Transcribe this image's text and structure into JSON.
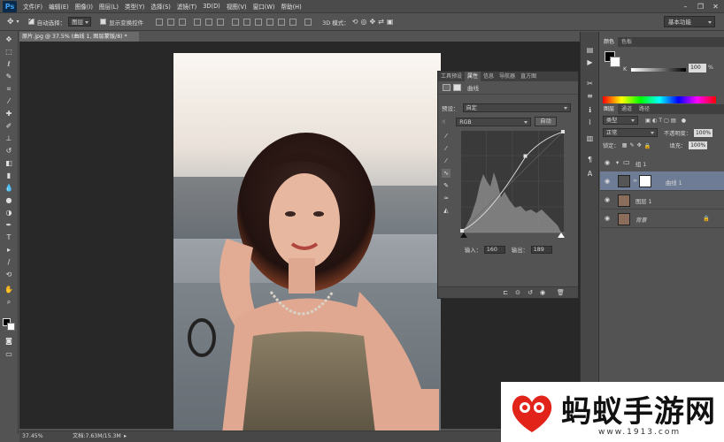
{
  "app": {
    "logo": "Ps"
  },
  "menu": [
    "文件(F)",
    "编辑(E)",
    "图像(I)",
    "图层(L)",
    "类型(Y)",
    "选择(S)",
    "滤镜(T)",
    "3D(D)",
    "视图(V)",
    "窗口(W)",
    "帮助(H)"
  ],
  "options": {
    "auto_select_label": "自动选择：",
    "auto_select_value": "图层",
    "show_transform_label": "显示变换控件",
    "mode_3d_label": "3D 模式："
  },
  "workspace": "基本功能",
  "document": {
    "tab_title": "原片.jpg @ 37.5% (曲线 1, 图层蒙版/8) *",
    "zoom": "37.45%",
    "doc_size": "文档:7.63M/15.3M"
  },
  "properties": {
    "tabs": [
      "工具预设",
      "属性",
      "信息",
      "导航器",
      "直方图"
    ],
    "active_tab": "属性",
    "title": "曲线",
    "preset_label": "预设：",
    "preset_value": "自定",
    "channel_value": "RGB",
    "auto_label": "自动",
    "input_label": "输入：",
    "input_value": "160",
    "output_label": "输出：",
    "output_value": "189"
  },
  "color_panel": {
    "tabs": [
      "颜色",
      "色板"
    ],
    "channel": "K",
    "value": "100",
    "unit": "%"
  },
  "layers_panel": {
    "tabs": [
      "图层",
      "通道",
      "路径"
    ],
    "filter": "类型",
    "blend_mode": "正常",
    "opacity_label": "不透明度：",
    "opacity": "100%",
    "lock_label": "锁定：",
    "fill_label": "填充：",
    "fill": "100%",
    "layers": [
      {
        "name": "组 1"
      },
      {
        "name": "曲线 1"
      },
      {
        "name": "图层 1"
      },
      {
        "name": "背景"
      }
    ]
  },
  "watermark": {
    "brand": "蚂蚁手游网",
    "url": "www.1913.com"
  },
  "icons": {
    "move": "move-tool-icon",
    "eye": "eye-icon",
    "lock": "lock-icon",
    "folder": "folder-icon"
  },
  "colors": {
    "accent_selection": "#6e7d95",
    "ps_blue": "#3ea2f7",
    "watermark_red": "#e2231a"
  }
}
